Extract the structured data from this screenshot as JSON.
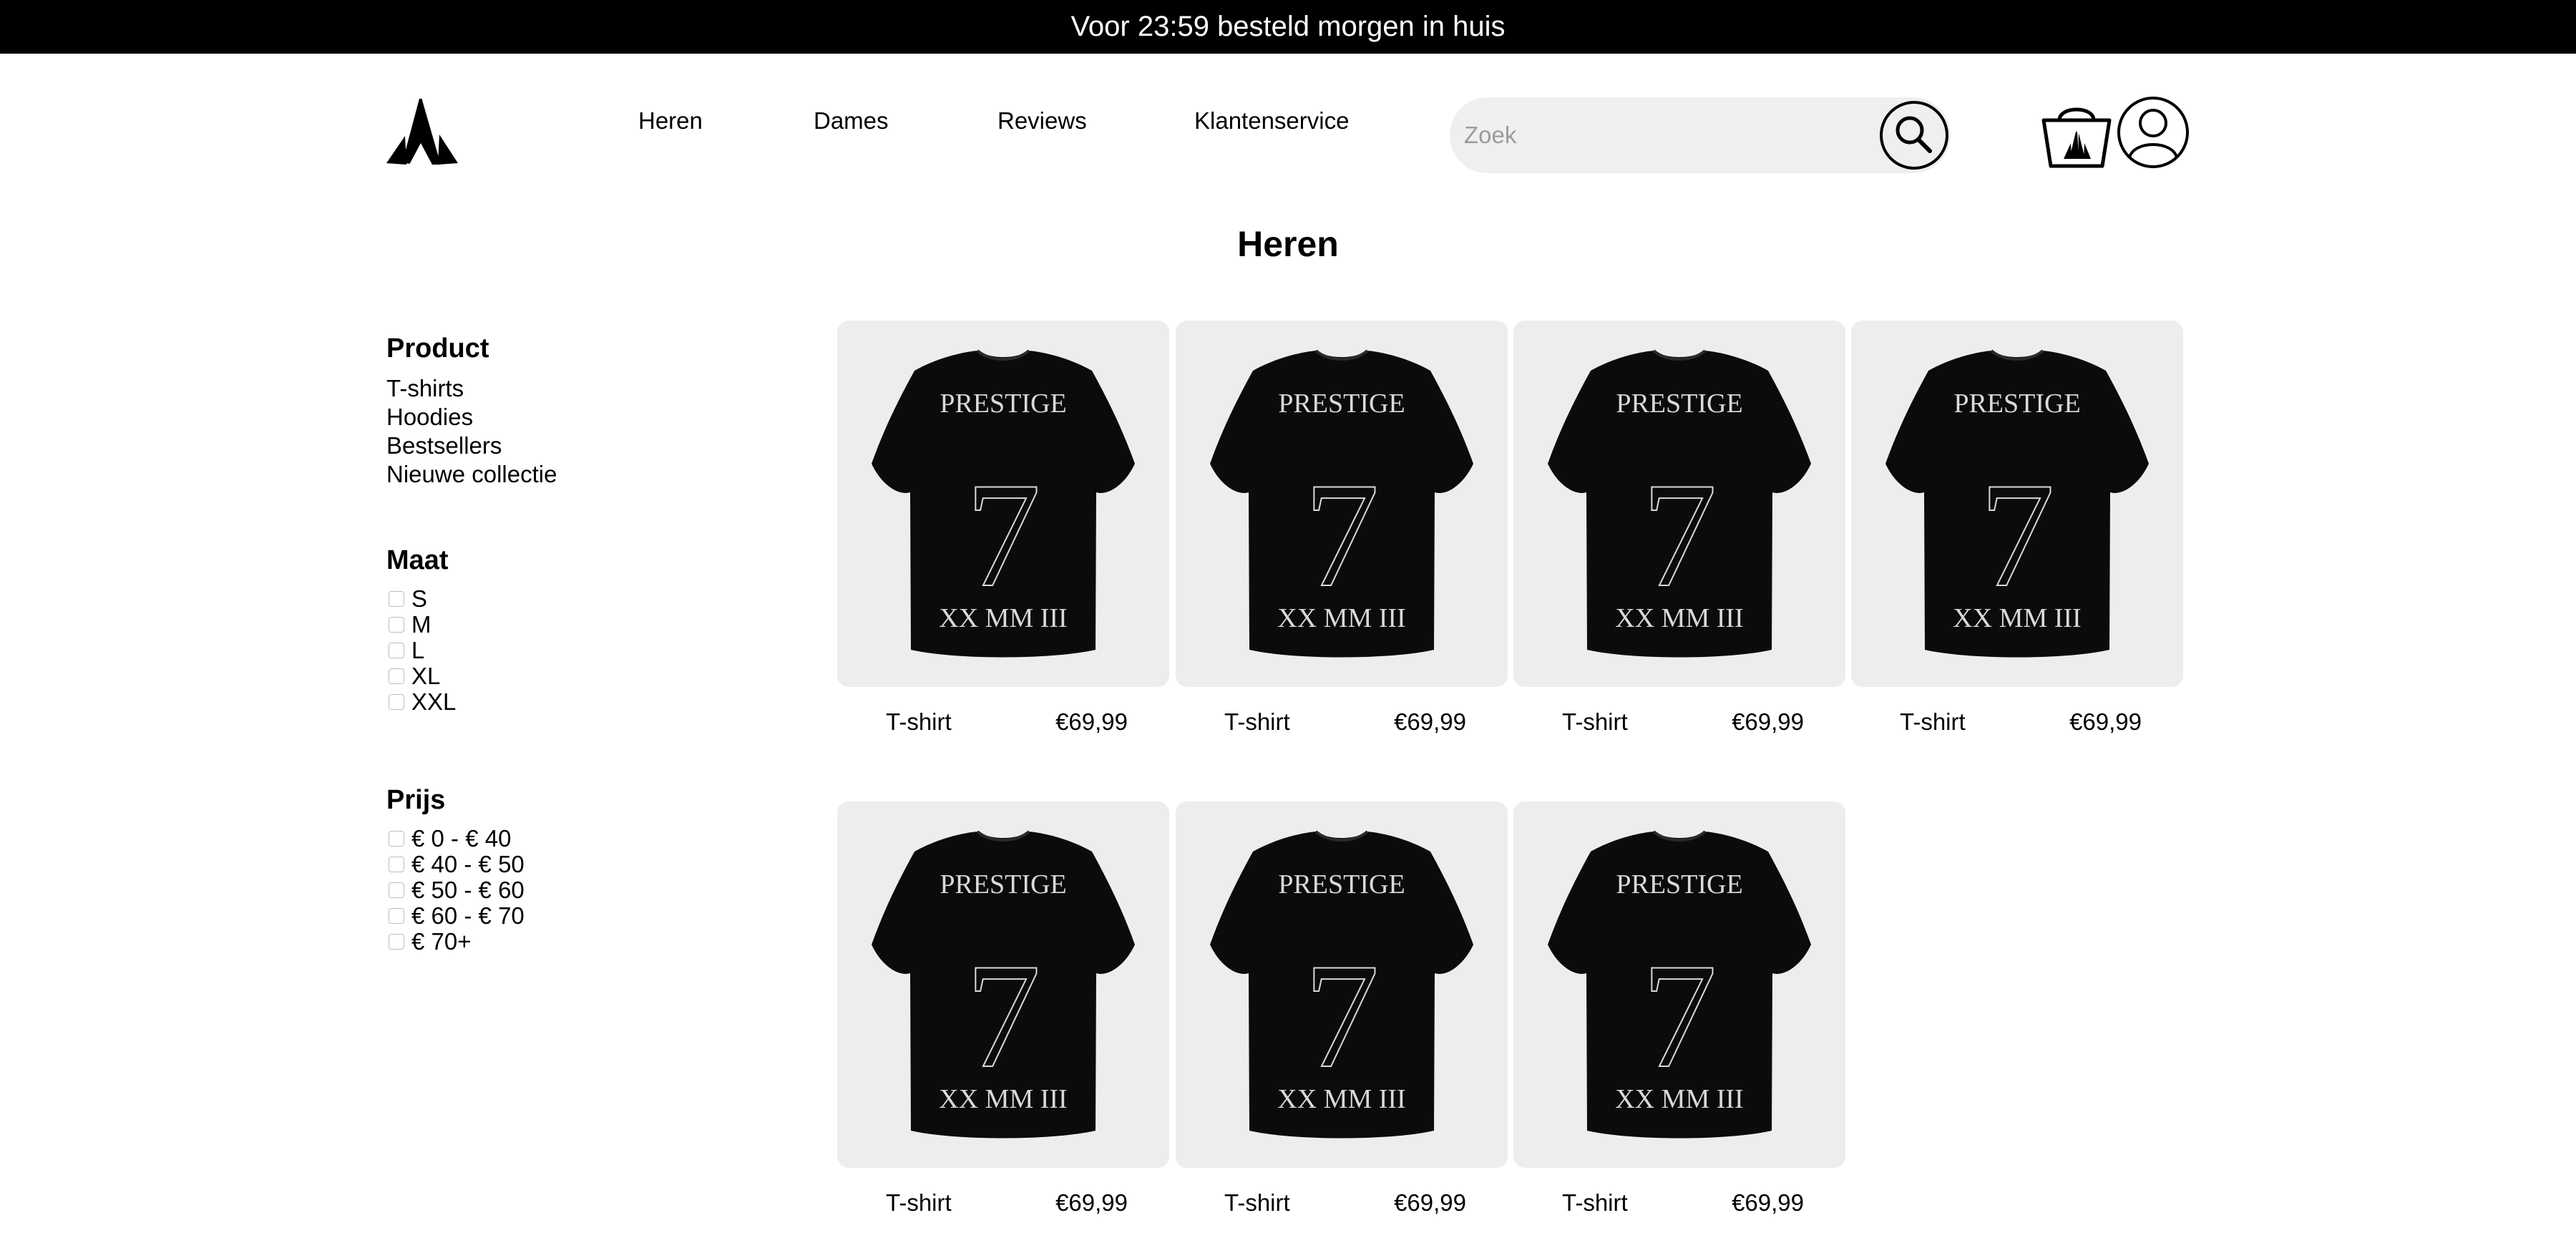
{
  "announcement": "Voor 23:59 besteld morgen in huis",
  "nav": {
    "items": [
      {
        "label": "Heren"
      },
      {
        "label": "Dames"
      },
      {
        "label": "Reviews"
      },
      {
        "label": "Klantenservice"
      }
    ]
  },
  "search": {
    "placeholder": "Zoek"
  },
  "page_title": "Heren",
  "filters": {
    "product": {
      "heading": "Product",
      "items": [
        "T-shirts",
        "Hoodies",
        "Bestsellers",
        "Nieuwe collectie"
      ]
    },
    "size": {
      "heading": "Maat",
      "options": [
        "S",
        "M",
        "L",
        "XL",
        "XXL"
      ]
    },
    "price": {
      "heading": "Prijs",
      "options": [
        "€ 0 - € 40",
        "€ 40 - € 50",
        "€ 50 - € 60",
        "€ 60 - € 70",
        "€ 70+"
      ]
    }
  },
  "products": [
    {
      "name": "T-shirt",
      "price": "€69,99",
      "print": {
        "top": "PRESTIGE",
        "number": "7",
        "bottom": "XX MM III"
      }
    },
    {
      "name": "T-shirt",
      "price": "€69,99",
      "print": {
        "top": "PRESTIGE",
        "number": "7",
        "bottom": "XX MM III"
      }
    },
    {
      "name": "T-shirt",
      "price": "€69,99",
      "print": {
        "top": "PRESTIGE",
        "number": "7",
        "bottom": "XX MM III"
      }
    },
    {
      "name": "T-shirt",
      "price": "€69,99",
      "print": {
        "top": "PRESTIGE",
        "number": "7",
        "bottom": "XX MM III"
      }
    },
    {
      "name": "T-shirt",
      "price": "€69,99",
      "print": {
        "top": "PRESTIGE",
        "number": "7",
        "bottom": "XX MM III"
      }
    },
    {
      "name": "T-shirt",
      "price": "€69,99",
      "print": {
        "top": "PRESTIGE",
        "number": "7",
        "bottom": "XX MM III"
      }
    },
    {
      "name": "T-shirt",
      "price": "€69,99",
      "print": {
        "top": "PRESTIGE",
        "number": "7",
        "bottom": "XX MM III"
      }
    }
  ],
  "icons": {
    "logo": "brand-logo-icon",
    "search": "magnifier-icon",
    "cart": "basket-icon",
    "account": "user-icon"
  },
  "colors": {
    "announcement_bg": "#000000",
    "search_bg": "#efefef",
    "card_bg": "#ededed",
    "shirt": "#0b0b0c",
    "print": "#d9d9d9"
  }
}
